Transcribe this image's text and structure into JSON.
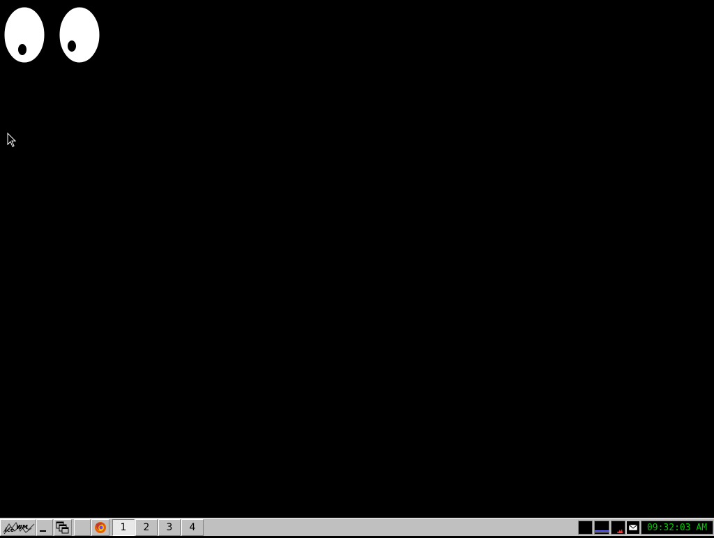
{
  "desktop": {
    "background": "#000000"
  },
  "xeyes": {
    "icon": "xeyes-eyes"
  },
  "taskbar": {
    "start_button": {
      "icon": "icewm-logo-icon",
      "label": "IceWM"
    },
    "minimize_button": {
      "icon": "minimize-icon"
    },
    "show_desktop_button": {
      "icon": "windows-stack-icon"
    },
    "firefox_button": {
      "icon": "firefox-icon"
    },
    "workspaces": [
      {
        "label": "1",
        "active": true
      },
      {
        "label": "2",
        "active": false
      },
      {
        "label": "3",
        "active": false
      },
      {
        "label": "4",
        "active": false
      }
    ],
    "tray": {
      "cpu_monitor": {
        "icon": "cpu-monitor-icon"
      },
      "net_monitor": {
        "icon": "network-monitor-icon"
      },
      "mem_monitor": {
        "icon": "memory-monitor-icon"
      },
      "mail": {
        "icon": "mail-icon"
      }
    },
    "clock": "09:32:03 AM",
    "colors": {
      "taskbar_bg": "#c0c0c0",
      "clock_fg": "#00c800"
    }
  }
}
